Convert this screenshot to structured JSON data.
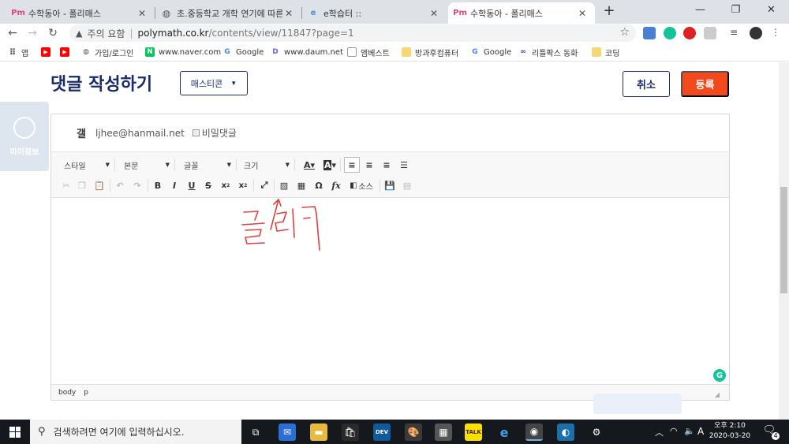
{
  "browser": {
    "tabs": [
      {
        "title": "수학동아 - 폴리매스",
        "favicon": "Pm",
        "active": false
      },
      {
        "title": "초.중등학교 개학 연기에 따른 온",
        "favicon": "globe-icon",
        "active": false
      },
      {
        "title": "e학습터 ::",
        "favicon": "e-icon",
        "active": false
      },
      {
        "title": "수학동아 - 폴리매스",
        "favicon": "Pm",
        "active": true
      }
    ],
    "security_label": "주의 요함",
    "url_host": "polymath.co.kr",
    "url_path": "/contents/view/11847?page=1",
    "bookmarks": [
      {
        "label": "앱"
      },
      {
        "label": ""
      },
      {
        "label": ""
      },
      {
        "label": "가입/로그인"
      },
      {
        "label": "www.naver.com"
      },
      {
        "label": "Google"
      },
      {
        "label": "www.daum.net"
      },
      {
        "label": "엠베스트"
      },
      {
        "label": "방과후컴퓨터"
      },
      {
        "label": "Google"
      },
      {
        "label": "리틀팍스 동화"
      },
      {
        "label": "코딩"
      }
    ]
  },
  "page": {
    "title": "댓글 작성하기",
    "emoticon_label": "매스티콘",
    "cancel_label": "취소",
    "submit_label": "등록",
    "myinfo_label": "마이정보"
  },
  "editor": {
    "nickname": "갤",
    "email": "ljhee@hanmail.net",
    "secret_label": "비밀댓글",
    "combos": [
      "스타일",
      "본문",
      "글꼴",
      "크기"
    ],
    "source_label": "소스",
    "handwritten_annotation": "클릭",
    "status_path": [
      "body",
      "p"
    ]
  },
  "taskbar": {
    "search_placeholder": "검색하려면 여기에 입력하십시오.",
    "time": "오후 2:10",
    "date": "2020-03-20",
    "ime": "A",
    "notification_count": "4"
  },
  "colors": {
    "title_navy": "#1a2b6b",
    "submit_orange": "#f24a1d",
    "annotation_red": "#e04040"
  }
}
